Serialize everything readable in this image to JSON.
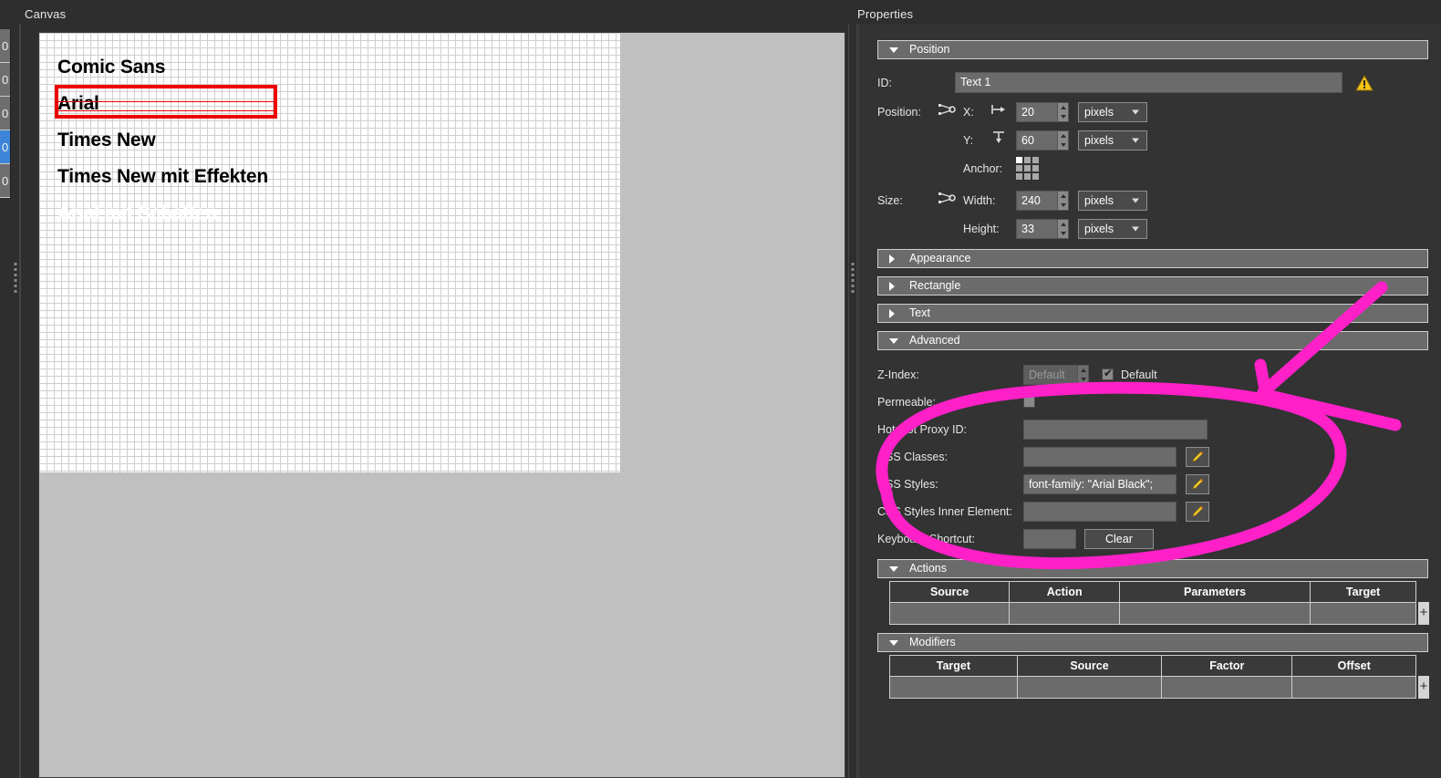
{
  "window": {
    "canvas_panel_title": "Canvas",
    "properties_panel_title": "Properties"
  },
  "colors": {
    "panel_bg": "#333333",
    "app_bg": "#2e2e2e",
    "section_header": "#6b6b6b",
    "field_bg": "#6b6b6b",
    "selection_red": "#ee0000",
    "annotation_pink": "#ff20c8",
    "list_selected_blue": "#3d85d8",
    "warning_yellow": "#f5c518",
    "canvas_surface": "#c0c0c0",
    "grid_line": "#cfcfcf"
  },
  "edge_list": {
    "rows": [
      {
        "label": "0",
        "selected": false
      },
      {
        "label": "0",
        "selected": false
      },
      {
        "label": "0",
        "selected": false
      },
      {
        "label": "0",
        "selected": true
      },
      {
        "label": "0",
        "selected": false
      }
    ]
  },
  "canvas": {
    "items": [
      {
        "text": "Comic Sans"
      },
      {
        "text": "Arial"
      },
      {
        "text": "Times New"
      },
      {
        "text": "Times New mit Effekten"
      },
      {
        "text": "Arial mit Schatten"
      }
    ],
    "selected_item_index": 1
  },
  "properties": {
    "sections": [
      {
        "label": "Position",
        "expanded": true
      },
      {
        "label": "Appearance",
        "expanded": false
      },
      {
        "label": "Rectangle",
        "expanded": false
      },
      {
        "label": "Text",
        "expanded": false
      },
      {
        "label": "Advanced",
        "expanded": true
      },
      {
        "label": "Actions",
        "expanded": true
      },
      {
        "label": "Modifiers",
        "expanded": true
      }
    ],
    "position": {
      "id_label": "ID:",
      "id_value": "Text 1",
      "position_label": "Position:",
      "x_label": "X:",
      "x_value": "20",
      "x_unit": "pixels",
      "y_label": "Y:",
      "y_value": "60",
      "y_unit": "pixels",
      "anchor_label": "Anchor:",
      "anchor_selected_cell": 0,
      "size_label": "Size:",
      "width_label": "Width:",
      "width_value": "240",
      "width_unit": "pixels",
      "height_label": "Height:",
      "height_value": "33",
      "height_unit": "pixels"
    },
    "advanced": {
      "zindex_label": "Z-Index:",
      "zindex_value": "Default",
      "zindex_default_label": "Default",
      "zindex_default_checked": true,
      "permeable_label": "Permeable:",
      "permeable_checked": false,
      "hotspot_label": "Hotspot Proxy ID:",
      "hotspot_value": "",
      "css_classes_label": "CSS Classes:",
      "css_classes_value": "",
      "css_styles_label": "CSS Styles:",
      "css_styles_value": "font-family: \"Arial Black\";",
      "css_styles_inner_label": "CSS Styles Inner Element:",
      "css_styles_inner_value": "",
      "keyboard_shortcut_label": "Keyboard Shortcut:",
      "keyboard_shortcut_value": "",
      "clear_button_label": "Clear"
    },
    "actions": {
      "title": "Actions",
      "columns": [
        "Source",
        "Action",
        "Parameters",
        "Target"
      ],
      "rows": [
        [
          "",
          "",
          "",
          ""
        ]
      ],
      "add_button_label": "+"
    },
    "modifiers": {
      "title": "Modifiers",
      "columns": [
        "Target",
        "Source",
        "Factor",
        "Offset"
      ],
      "rows": [
        [
          "",
          "",
          "",
          ""
        ]
      ],
      "add_button_label": "+"
    }
  }
}
